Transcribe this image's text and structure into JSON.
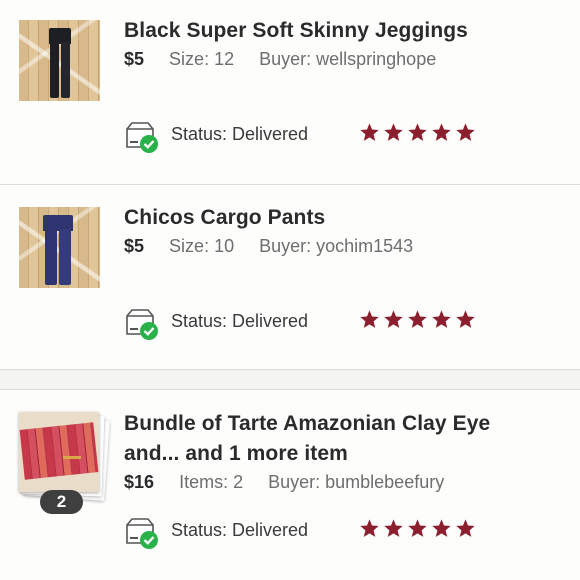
{
  "orders": [
    {
      "title": "Black Super Soft Skinny Jeggings",
      "price": "$5",
      "detail": "Size: 12",
      "buyer": "Buyer: wellspringhope",
      "status": "Status:  Delivered",
      "rating": 5,
      "thumbnail": "black-jeggings-photo"
    },
    {
      "title": "Chicos Cargo Pants",
      "price": "$5",
      "detail": "Size: 10",
      "buyer": "Buyer: yochim1543",
      "status": "Status:  Delivered",
      "rating": 5,
      "thumbnail": "navy-cargo-pants-photo"
    },
    {
      "title_line1": "Bundle of Tarte Amazonian Clay Eye",
      "title_line2": "and... and 1 more item",
      "price": "$16",
      "detail": "Items: 2",
      "buyer": "Buyer: bumblebeefury",
      "status": "Status:  Delivered",
      "rating": 5,
      "bundle_count": "2",
      "thumbnail": "eyeshadow-palette-photo"
    }
  ],
  "colors": {
    "star": "#8b1f2e",
    "check": "#29b24a",
    "black_pants": "#1e1f24",
    "navy_pants": "#2d3470"
  },
  "icons": [
    "package-delivered-icon",
    "star-icon"
  ]
}
